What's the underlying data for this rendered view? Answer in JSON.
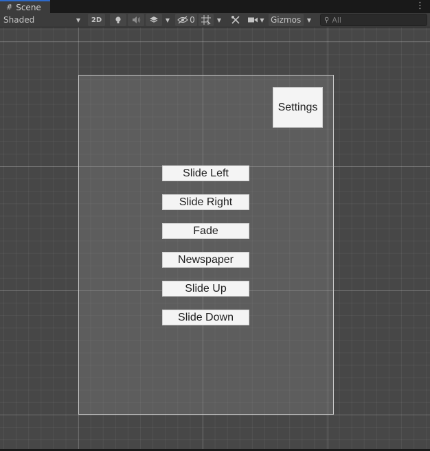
{
  "tab": {
    "icon": "grid-icon",
    "label": "Scene"
  },
  "toolbar": {
    "shading_mode": "Shaded",
    "mode_2d": "2D",
    "hidden_count": "0",
    "gizmos_label": "Gizmos",
    "search_placeholder": "All"
  },
  "scene": {
    "settings_button": "Settings",
    "menu_buttons": [
      "Slide Left",
      "Slide Right",
      "Fade",
      "Newspaper",
      "Slide Up",
      "Slide Down"
    ]
  }
}
